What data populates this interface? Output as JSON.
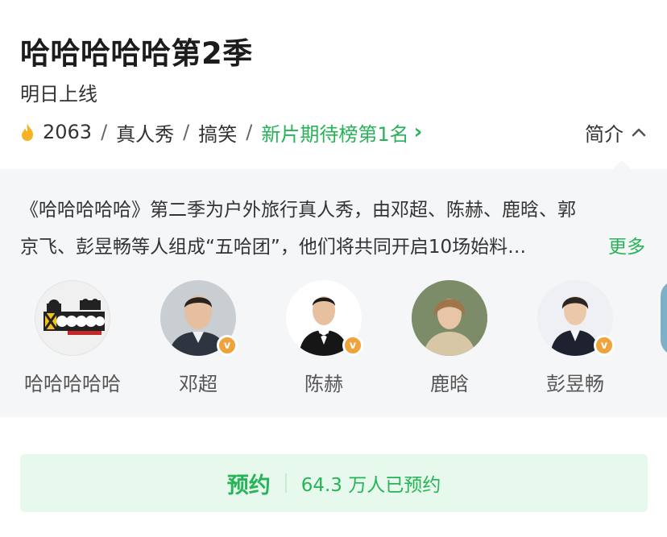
{
  "header": {
    "title": "哈哈哈哈哈第2季",
    "subtitle": "明日上线",
    "heat_icon": "flame-icon",
    "heat_count": "2063",
    "separator": "/",
    "genre_1": "真人秀",
    "genre_2": "搞笑",
    "rank_text": "新片期待榜第1名",
    "intro_label": "简介",
    "accent_color": "#27b357"
  },
  "description": {
    "line1": "《哈哈哈哈哈》第二季为户外旅行真人秀，由邓超、陈赫、鹿晗、郭",
    "line2": "京飞、彭昱畅等人组成“五哈团”，他们将共同开启10场始料…",
    "more_label": "更多"
  },
  "cast": [
    {
      "name": "哈哈哈哈哈",
      "verified": false
    },
    {
      "name": "邓超",
      "verified": true
    },
    {
      "name": "陈赫",
      "verified": true
    },
    {
      "name": "鹿晗",
      "verified": false
    },
    {
      "name": "彭昱畅",
      "verified": true
    }
  ],
  "badge_symbol": "v",
  "reserve": {
    "label": "预约",
    "count_text": "64.3 万人已预约"
  }
}
